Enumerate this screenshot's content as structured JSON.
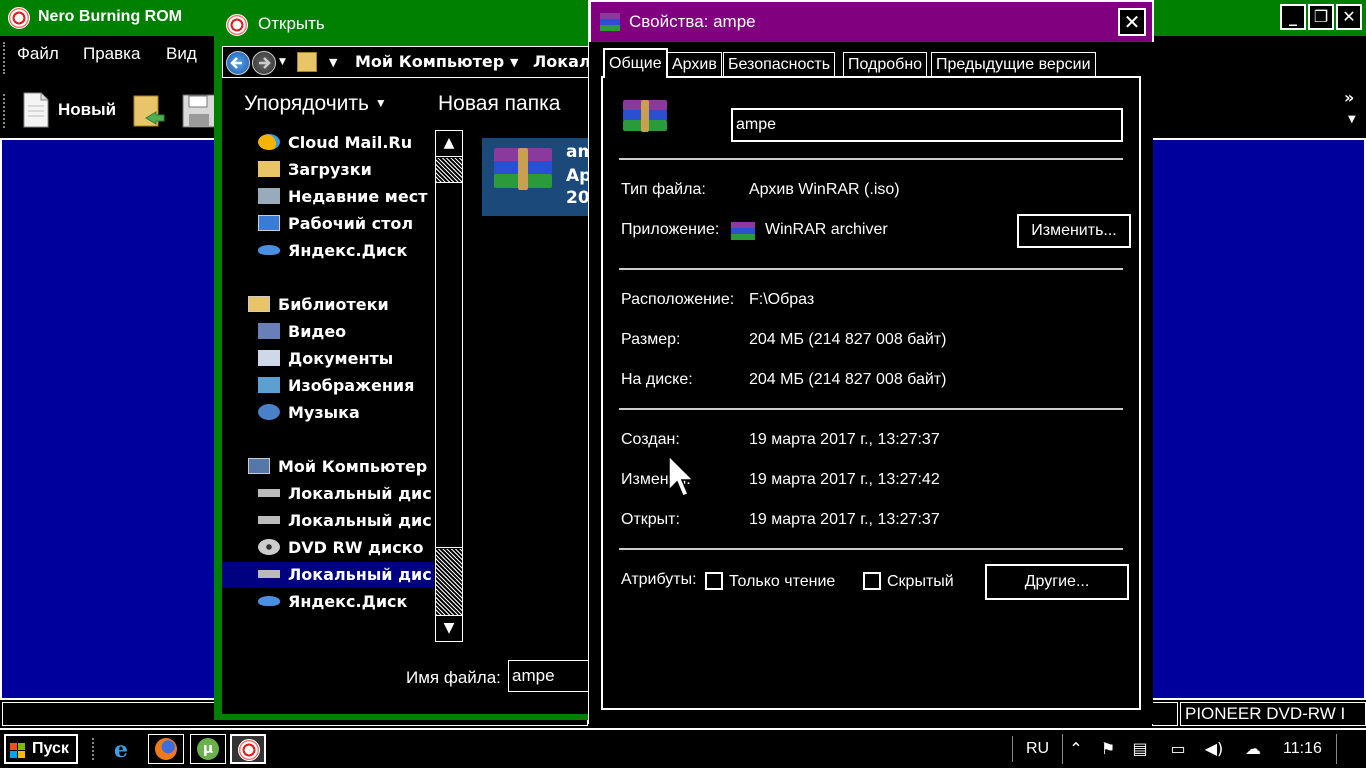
{
  "nero": {
    "title": "Nero Burning ROM",
    "menu": [
      "Файл",
      "Правка",
      "Вид"
    ],
    "toolbar_new": "Новый",
    "drive_label": "PIONEER  DVD-RW  I",
    "caption": {
      "minimize": "_",
      "restore": "❐",
      "close": "✕"
    }
  },
  "open_dialog": {
    "title": "Открыть",
    "address": {
      "computer": "Мой Компьютер",
      "next": "Локал"
    },
    "organize": "Упорядочить",
    "new_folder": "Новая папка",
    "tree": [
      {
        "label": "Cloud Mail.Ru",
        "icon": "cloud-icon"
      },
      {
        "label": "Загрузки",
        "icon": "downloads-icon"
      },
      {
        "label": "Недавние мест",
        "icon": "recent-icon"
      },
      {
        "label": "Рабочий стол",
        "icon": "desktop-icon"
      },
      {
        "label": "Яндекс.Диск",
        "icon": "yandex-disk-icon"
      },
      {
        "label": "Библиотеки",
        "icon": "libraries-icon"
      },
      {
        "label": "Видео",
        "icon": "video-icon"
      },
      {
        "label": "Документы",
        "icon": "documents-icon"
      },
      {
        "label": "Изображения",
        "icon": "pictures-icon"
      },
      {
        "label": "Музыка",
        "icon": "music-icon"
      },
      {
        "label": "Мой Компьютер",
        "icon": "computer-icon"
      },
      {
        "label": "Локальный дис",
        "icon": "local-disk-icon"
      },
      {
        "label": "Локальный дис",
        "icon": "local-disk-icon"
      },
      {
        "label": "DVD RW диско",
        "icon": "dvd-icon"
      },
      {
        "label": "Локальный дис",
        "icon": "local-disk-icon"
      },
      {
        "label": "Яндекс.Диск",
        "icon": "yandex-disk-icon"
      }
    ],
    "file_item": {
      "line1": "am",
      "line2": "Ар",
      "line3": "20"
    },
    "filename_label": "Имя файла:",
    "filename_value": "ampe"
  },
  "properties": {
    "title": "Свойства: ampe",
    "tabs": [
      "Общие",
      "Архив",
      "Безопасность",
      "Подробно",
      "Предыдущие версии"
    ],
    "active_tab": "Общие",
    "name": "ampe",
    "file_type_label": "Тип файла:",
    "file_type": "Архив WinRAR (.iso)",
    "app_label": "Приложение:",
    "app": "WinRAR archiver",
    "change_button": "Изменить...",
    "location_label": "Расположение:",
    "location": "F:\\Образ",
    "size_label": "Размер:",
    "size": "204 МБ (214 827 008 байт)",
    "disk_label": "На диске:",
    "disk_size": "204 МБ (214 827 008 байт)",
    "created_label": "Создан:",
    "created": "19 марта 2017 г., 13:27:37",
    "modified_label": "Изменен:",
    "modified": "19 марта 2017 г., 13:27:42",
    "opened_label": "Открыт:",
    "opened": "19 марта 2017 г., 13:27:37",
    "attributes_label": "Атрибуты:",
    "readonly_label": "Только чтение",
    "hidden_label": "Скрытый",
    "readonly_checked": false,
    "hidden_checked": false,
    "other_button": "Другие..."
  },
  "taskbar": {
    "start": "Пуск",
    "apps": [
      "internet-explorer-icon",
      "firefox-icon",
      "utorrent-icon",
      "nero-icon"
    ],
    "lang": "RU",
    "clock": "11:16"
  },
  "colors": {
    "nero_title": "#008000",
    "props_title": "#800080",
    "workspace": "#00009c",
    "selection": "#000080"
  }
}
